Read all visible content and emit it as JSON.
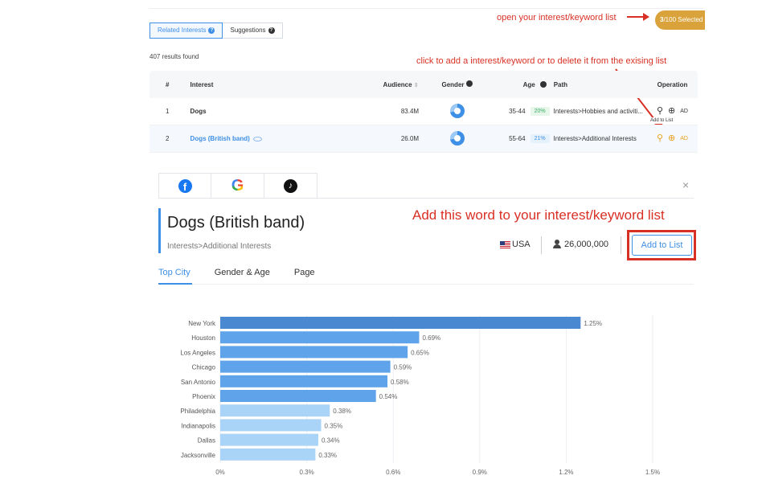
{
  "top_panel": {
    "annotation_open_list": "open your interest/keyword list",
    "selected_pill": {
      "count": "3",
      "suffix": "/100 Selected"
    },
    "tabs": [
      {
        "label": "Related Interests",
        "active": true
      },
      {
        "label": "Suggestions",
        "active": false
      }
    ],
    "results_text": "407 results found",
    "annotation_add": "click to add a interest/keyword or to delete it from the exising list",
    "table": {
      "headers": {
        "num": "#",
        "interest": "Interest",
        "audience": "Audience",
        "gender": "Gender",
        "age": "Age",
        "path": "Path",
        "operation": "Operation"
      },
      "rows": [
        {
          "num": "1",
          "interest": "Dogs",
          "audience": "83.4M",
          "age": "35-44",
          "age_pct": "20%",
          "path": "Interests>Hobbies and activiti..."
        },
        {
          "num": "2",
          "interest": "Dogs (British band)",
          "audience": "26.0M",
          "age": "55-64",
          "age_pct": "21%",
          "path": "Interests>Additional Interests"
        }
      ],
      "tooltip": "Add to List",
      "ad_icon_text": "AD"
    }
  },
  "modal": {
    "platforms": [
      {
        "name": "Facebook",
        "icon": "facebook-icon"
      },
      {
        "name": "Google",
        "icon": "google-icon"
      },
      {
        "name": "TikTok",
        "icon": "tiktok-icon"
      }
    ],
    "close_symbol": "×",
    "title": "Dogs (British band)",
    "subtitle": "Interests>Additional Interests",
    "annotation": "Add this word to your interest/keyword list",
    "country": "USA",
    "audience": "26,000,000",
    "add_button": "Add to List",
    "sub_tabs": [
      {
        "label": "Top City",
        "active": true
      },
      {
        "label": "Gender & Age",
        "active": false
      },
      {
        "label": "Page",
        "active": false
      }
    ]
  },
  "colors": {
    "accent": "#3e8fe6",
    "annotation_red": "#d93025",
    "pill_orange": "#d9a23a",
    "bar_dark": "#4a88d2",
    "bar_mid": "#5fa3ea",
    "bar_light": "#a9d3f7"
  },
  "chart_data": {
    "type": "bar",
    "orientation": "horizontal",
    "categories": [
      "New York",
      "Houston",
      "Los Angeles",
      "Chicago",
      "San Antonio",
      "Phoenix",
      "Philadelphia",
      "Indianapolis",
      "Dallas",
      "Jacksonville"
    ],
    "values": [
      1.25,
      0.69,
      0.65,
      0.59,
      0.58,
      0.54,
      0.38,
      0.35,
      0.34,
      0.33
    ],
    "value_labels": [
      "1.25%",
      "0.69%",
      "0.65%",
      "0.59%",
      "0.58%",
      "0.54%",
      "0.38%",
      "0.35%",
      "0.34%",
      "0.33%"
    ],
    "xlim": [
      0,
      1.5
    ],
    "xticks": [
      0,
      0.3,
      0.6,
      0.9,
      1.2,
      1.5
    ],
    "xtick_labels": [
      "0%",
      "0.3%",
      "0.6%",
      "0.9%",
      "1.2%",
      "1.5%"
    ],
    "grid": true,
    "title": "",
    "xlabel": "",
    "ylabel": ""
  }
}
